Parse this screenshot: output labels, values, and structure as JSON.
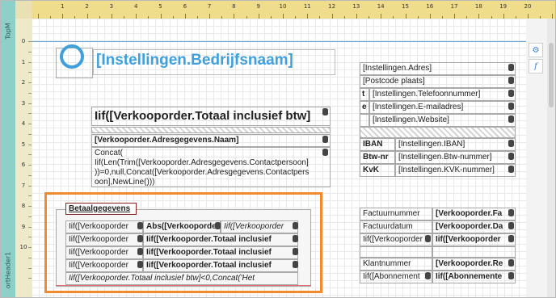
{
  "bands": {
    "top": "TopM",
    "header": "ortHeader1"
  },
  "ruler": {
    "h": [
      "1",
      "2",
      "3",
      "4",
      "5",
      "6",
      "7",
      "8",
      "9",
      "10",
      "11",
      "12",
      "13",
      "14",
      "15",
      "16",
      "17",
      "18",
      "19",
      "20"
    ],
    "v": [
      "0",
      "1",
      "2",
      "3",
      "4",
      "5",
      "6",
      "7",
      "8",
      "9",
      "10"
    ]
  },
  "tools": {
    "settings_icon": "gear-icon",
    "function_icon": "function-icon",
    "gear_glyph": "⚙",
    "function_glyph": "f"
  },
  "header": {
    "title": "[Instellingen.Bedrijfsnaam]"
  },
  "company": {
    "address": "[Instellingen.Adres]",
    "postcode": "[Postcode plaats]",
    "phone_label": "t",
    "phone": "[Instellingen.Telefoonnummer]",
    "email_label": "e",
    "email": "[Instellingen.E-mailadres]",
    "website": "[Instellingen.Website]",
    "iban_label": "IBAN",
    "iban": "[Instellingen.IBAN]",
    "btw_label": "Btw-nr",
    "btw": "[Instellingen.Btw-nummer]",
    "kvk_label": "KvK",
    "kvk": "[Instellingen.KVK-nummer]"
  },
  "order": {
    "total": "Iif([Verkooporder.Totaal inclusief btw]",
    "name": "[Verkooporder.Adresgegevens.Naam]",
    "contact_lines": [
      "Concat(",
      "Iif(Len(Trim([Verkooporder.Adresgegevens.Contactpersoon]",
      "))=0,null,Concat([Verkooporder.Adresgegevens.Contactpers",
      "oon],NewLine()))"
    ]
  },
  "payment": {
    "heading": "Betaalgegevens",
    "rows": [
      [
        "Iif([Verkooporder",
        "Abs([Verkooporde",
        "Iif([Verkooporder"
      ],
      [
        "Iif([Verkooporder",
        "Iif([Verkooporder.Totaal inclusief"
      ],
      [
        "Iif([Verkooporder",
        "Iif([Verkooporder.Totaal inclusief"
      ],
      [
        "Iif([Verkooporder",
        "Iif([Verkooporder.Totaal inclusief"
      ]
    ],
    "footer": "Iif([Verkooporder.Totaal inclusief btw]<0,Concat('Het"
  },
  "invoice": {
    "number_label": "Factuurnummer",
    "number_value": "[Verkooporder.Fa",
    "date_label": "Factuurdatum",
    "date_value": "[Verkooporder.Da",
    "row3_label": "Iif([Verkooporder",
    "row3_value": "Iif([Verkooporder",
    "client_label": "Klantnummer",
    "client_value": "[Verkooporder.Re",
    "sub_label": "Iif([Abonnement",
    "sub_value": "Iif([Abonnemente"
  }
}
